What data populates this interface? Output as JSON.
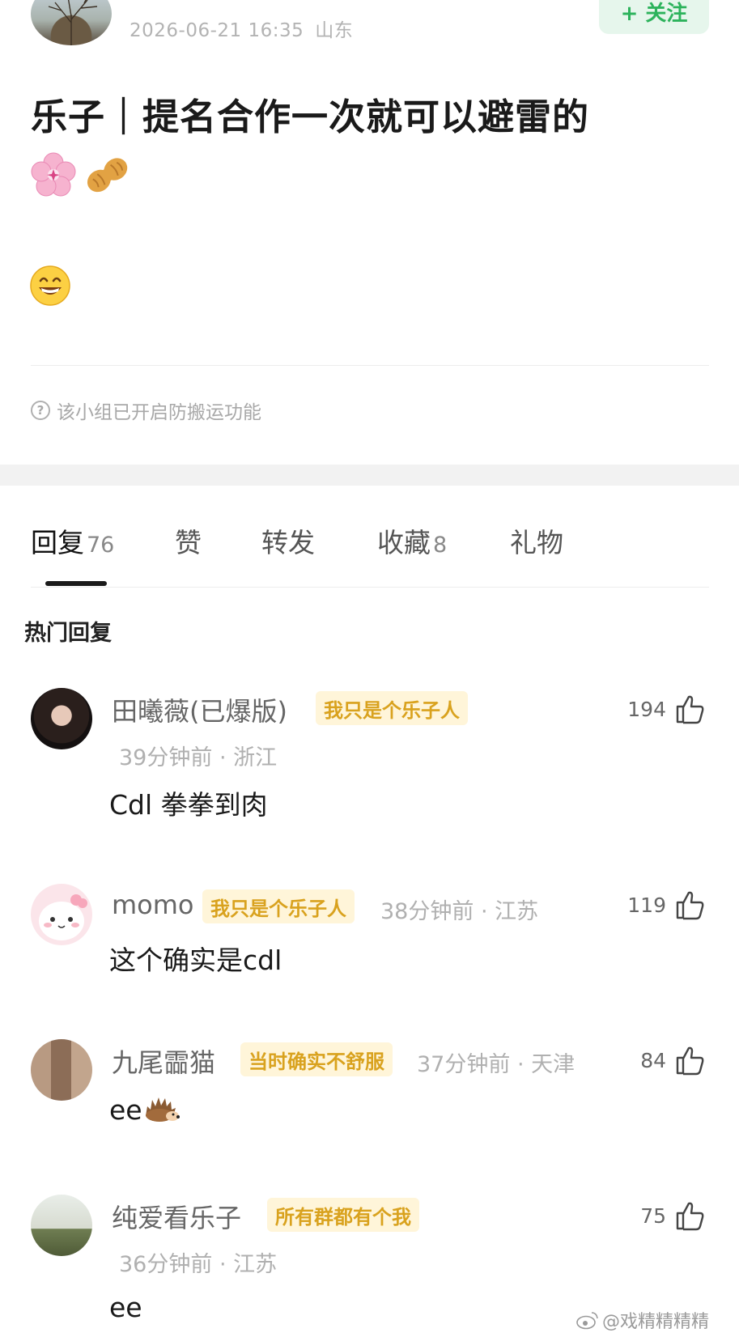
{
  "post": {
    "date": "2026-06-21 16:35",
    "location": "山东",
    "follow_label": "+ 关注",
    "title": "乐子｜提名合作一次就可以避雷的",
    "emojis": [
      "flower-emoji",
      "peanut-emoji"
    ],
    "reaction_emoji": "grin-emoji",
    "notice": "该小组已开启防搬运功能"
  },
  "tabs": [
    {
      "label": "回复",
      "count": "76"
    },
    {
      "label": "赞",
      "count": ""
    },
    {
      "label": "转发",
      "count": ""
    },
    {
      "label": "收藏",
      "count": "8"
    },
    {
      "label": "礼物",
      "count": ""
    }
  ],
  "active_tab": "回复",
  "section_title": "热门回复",
  "comments": [
    {
      "name": "田曦薇(已爆版)",
      "badge": "我只是个乐子人",
      "time_location": "39分钟前 · 浙江",
      "text": "Cdl  拳拳到肉",
      "likes": "194"
    },
    {
      "name": "momo",
      "badge": "我只是个乐子人",
      "time_location": "38分钟前 · 江苏",
      "text": "这个确实是cdl",
      "likes": "119"
    },
    {
      "name": "九尾霝猫",
      "badge": "当时确实不舒服",
      "time_location": "37分钟前 · 天津",
      "text": "ee",
      "text_emoji": "hedgehog-emoji",
      "likes": "84"
    },
    {
      "name": "纯爱看乐子",
      "badge": "所有群都有个我",
      "time_location": "36分钟前 · 江苏",
      "text": "ee",
      "likes": "75"
    }
  ],
  "watermark": "@戏精精精精",
  "colors": {
    "accent_green": "#2db35c",
    "badge_bg": "#fff5d9",
    "badge_text": "#d9a21e"
  }
}
